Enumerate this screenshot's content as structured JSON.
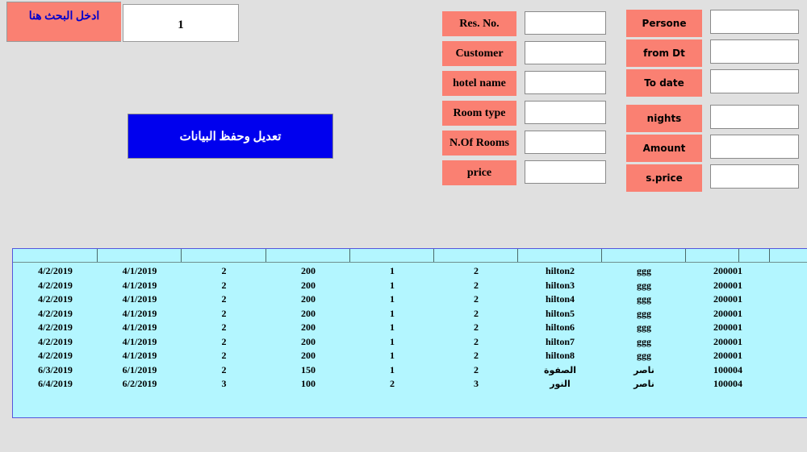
{
  "search": {
    "label": "ادخل البحث هنا",
    "value": "1",
    "placeholder": ""
  },
  "actions": {
    "save_label": "تعديل وحفظ البيانات"
  },
  "form": {
    "left_column": [
      {
        "label": "Res. No.",
        "value": ""
      },
      {
        "label": "Customer",
        "value": ""
      },
      {
        "label": "hotel name",
        "value": ""
      },
      {
        "label": "Room type",
        "value": ""
      },
      {
        "label": "N.Of Rooms",
        "value": ""
      },
      {
        "label": "price",
        "value": ""
      }
    ],
    "right_column": [
      {
        "label": "Persone",
        "value": ""
      },
      {
        "label": "from Dt",
        "value": ""
      },
      {
        "label": "To date",
        "value": ""
      },
      {
        "label": "nights",
        "value": ""
      },
      {
        "label": "Amount",
        "value": ""
      },
      {
        "label": "s.price",
        "value": ""
      }
    ]
  },
  "grid": {
    "headers": [
      "",
      "",
      "",
      "",
      "",
      "",
      "",
      "",
      "",
      "",
      ""
    ],
    "rows": [
      [
        "4/2/2019",
        "4/1/2019",
        "2",
        "200",
        "1",
        "2",
        "hilton2",
        "ggg",
        "200001",
        "",
        ""
      ],
      [
        "4/2/2019",
        "4/1/2019",
        "2",
        "200",
        "1",
        "2",
        "hilton3",
        "ggg",
        "200001",
        "",
        ""
      ],
      [
        "4/2/2019",
        "4/1/2019",
        "2",
        "200",
        "1",
        "2",
        "hilton4",
        "ggg",
        "200001",
        "",
        ""
      ],
      [
        "4/2/2019",
        "4/1/2019",
        "2",
        "200",
        "1",
        "2",
        "hilton5",
        "ggg",
        "200001",
        "",
        ""
      ],
      [
        "4/2/2019",
        "4/1/2019",
        "2",
        "200",
        "1",
        "2",
        "hilton6",
        "ggg",
        "200001",
        "",
        ""
      ],
      [
        "4/2/2019",
        "4/1/2019",
        "2",
        "200",
        "1",
        "2",
        "hilton7",
        "ggg",
        "200001",
        "",
        ""
      ],
      [
        "4/2/2019",
        "4/1/2019",
        "2",
        "200",
        "1",
        "2",
        "hilton8",
        "ggg",
        "200001",
        "",
        ""
      ],
      [
        "6/3/2019",
        "6/1/2019",
        "2",
        "150",
        "1",
        "2",
        "الصفوة",
        "ناصر",
        "100004",
        "",
        ""
      ],
      [
        "6/4/2019",
        "6/2/2019",
        "3",
        "100",
        "2",
        "3",
        "النور",
        "ناصر",
        "100004",
        "",
        ""
      ]
    ]
  },
  "colors": {
    "background": "#e0e0e0",
    "label_pink": "#fa8072",
    "button_blue": "#0000ee",
    "search_text_blue": "#0000cc",
    "grid_cyan": "#b3f6ff",
    "grid_border": "#5555dd"
  }
}
